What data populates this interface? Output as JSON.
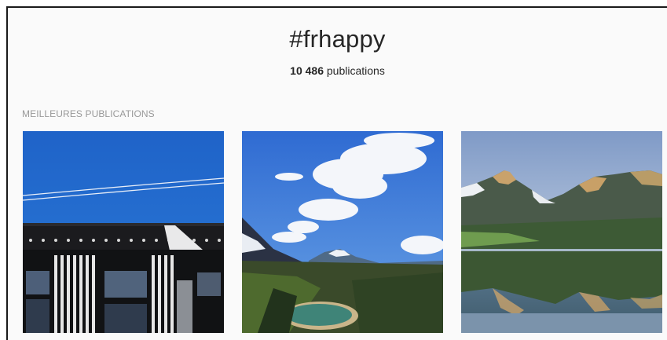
{
  "header": {
    "hashtag": "#frhappy",
    "post_count": "10 486",
    "post_count_suffix": "publications"
  },
  "section": {
    "top_posts_label": "MEILLEURES PUBLICATIONS"
  },
  "posts": [
    {
      "subject": "building-facade-blue-sky"
    },
    {
      "subject": "mountain-lake-valley-clouds"
    },
    {
      "subject": "mountain-lake-reflection"
    }
  ]
}
